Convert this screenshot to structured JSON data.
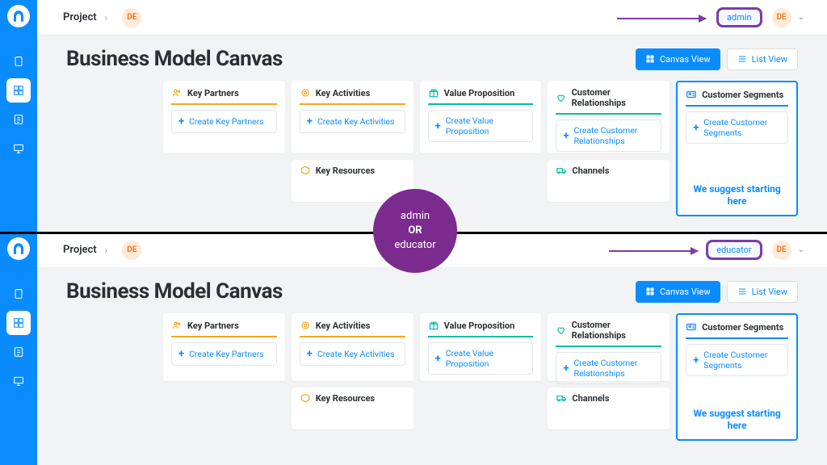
{
  "breadcrumb": {
    "label": "Project",
    "badge": "DE"
  },
  "user": {
    "initials": "DE"
  },
  "page_title": "Business Model Canvas",
  "views": {
    "canvas": "Canvas View",
    "list": "List View"
  },
  "roles": {
    "admin": "admin",
    "educator": "educator"
  },
  "center": {
    "line1": "admin",
    "or": "OR",
    "line2": "educator"
  },
  "cards": {
    "key_partners": {
      "title": "Key Partners",
      "create": "Create Key Partners"
    },
    "key_activities": {
      "title": "Key Activities",
      "create": "Create Key Activities"
    },
    "value_prop": {
      "title": "Value Proposition",
      "create": "Create Value Proposition"
    },
    "cust_rel": {
      "title": "Customer Relationships",
      "create": "Create Customer Relationships"
    },
    "cust_seg": {
      "title": "Customer Segments",
      "create": "Create Customer Segments",
      "suggest": "We suggest starting here"
    },
    "key_res": {
      "title": "Key Resources"
    },
    "channels": {
      "title": "Channels"
    }
  },
  "colors": {
    "primary": "#0a8cff",
    "accent_orange": "#f5a623",
    "accent_teal": "#00bfa5",
    "callout": "#7b3da8",
    "circle": "#7b2b8e"
  }
}
